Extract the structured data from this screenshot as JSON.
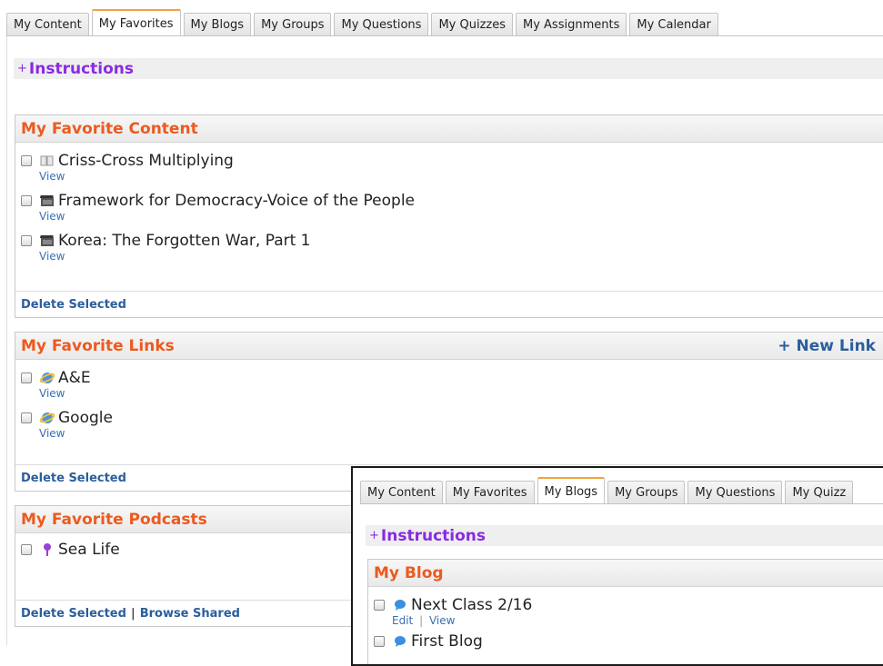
{
  "main": {
    "tabs": [
      {
        "label": "My Content",
        "active": false
      },
      {
        "label": "My Favorites",
        "active": true
      },
      {
        "label": "My Blogs",
        "active": false
      },
      {
        "label": "My Groups",
        "active": false
      },
      {
        "label": "My Questions",
        "active": false
      },
      {
        "label": "My Quizzes",
        "active": false
      },
      {
        "label": "My Assignments",
        "active": false
      },
      {
        "label": "My Calendar",
        "active": false
      }
    ],
    "instructions": {
      "plus": "+",
      "label": "Instructions"
    },
    "content_panel": {
      "title": "My Favorite Content",
      "items": [
        {
          "title": "Criss-Cross Multiplying",
          "icon": "book-icon",
          "action": "View"
        },
        {
          "title": "Framework for Democracy-Voice of the People",
          "icon": "film-icon",
          "action": "View"
        },
        {
          "title": "Korea: The Forgotten War, Part 1",
          "icon": "film-icon",
          "action": "View"
        }
      ],
      "footer": "Delete Selected"
    },
    "links_panel": {
      "title": "My Favorite Links",
      "new_link": "+ New Link",
      "items": [
        {
          "title": "A&E",
          "icon": "web-globe-icon",
          "action": "View"
        },
        {
          "title": "Google",
          "icon": "web-globe-icon",
          "action": "View"
        }
      ],
      "footer": "Delete Selected"
    },
    "podcasts_panel": {
      "title": "My Favorite Podcasts",
      "items": [
        {
          "title": "Sea Life",
          "icon": "podcast-icon"
        }
      ],
      "footer_delete": "Delete Selected",
      "footer_separator": "|",
      "footer_browse": "Browse Shared"
    }
  },
  "overlay": {
    "tabs": [
      {
        "label": "My Content",
        "active": false
      },
      {
        "label": "My Favorites",
        "active": false
      },
      {
        "label": "My Blogs",
        "active": true
      },
      {
        "label": "My Groups",
        "active": false
      },
      {
        "label": "My Questions",
        "active": false
      },
      {
        "label": "My Quizz",
        "active": false
      }
    ],
    "instructions": {
      "plus": "+",
      "label": "Instructions"
    },
    "blog_panel": {
      "title": "My Blog",
      "items": [
        {
          "title": "Next Class 2/16",
          "icon": "blog-bubble-icon",
          "edit": "Edit",
          "separator": "|",
          "view": "View"
        },
        {
          "title": "First Blog",
          "icon": "blog-bubble-icon"
        }
      ]
    }
  },
  "colors": {
    "panel_title": "#ec5a1f",
    "instructions": "#8a2be2",
    "link": "#2b5e9c",
    "active_tab_accent": "#f3a33a"
  }
}
